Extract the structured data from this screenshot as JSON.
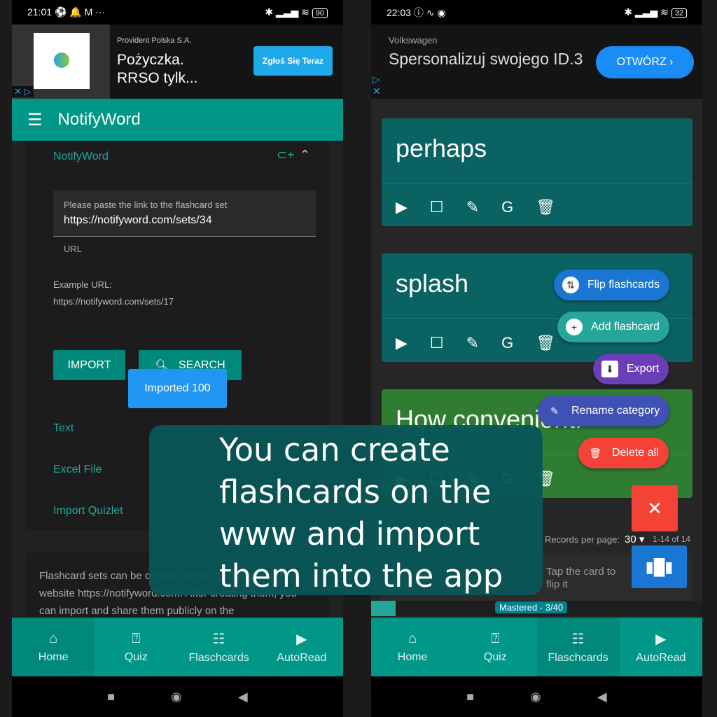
{
  "left": {
    "status": {
      "time": "21:01",
      "icons": "⚽ 🔔 M ···",
      "battery": "90"
    },
    "ad": {
      "advertiser": "Provident Polska S.A.",
      "headline": "Pożyczka. RRSO tylk...",
      "cta": "Zgłoś Się Teraz",
      "badge": "✕ ▷"
    },
    "appbar": {
      "title": "NotifyWord"
    },
    "section": {
      "title": "NotifyWord"
    },
    "url_field": {
      "label": "Please paste the link to the flashcard set",
      "value": "https://notifyword.com/sets/34",
      "helper": "URL"
    },
    "example": {
      "label": "Example URL:",
      "value": "https://notifyword.com/sets/17"
    },
    "buttons": {
      "import": "IMPORT",
      "search": "SEARCH"
    },
    "toast": "Imported 100",
    "sections": [
      "Text",
      "Excel File",
      "Import Quizlet"
    ],
    "info": "Flashcard sets can be created on the computer on the website https://notifyword.com. After creating them, you can import and share them publicly on the",
    "nav": [
      {
        "label": "Home",
        "icon": "home-icon"
      },
      {
        "label": "Quiz",
        "icon": "quiz-icon"
      },
      {
        "label": "Flaschcards",
        "icon": "list-icon"
      },
      {
        "label": "AutoRead",
        "icon": "play-icon"
      }
    ]
  },
  "right": {
    "status": {
      "time": "22:03",
      "battery": "32"
    },
    "ad": {
      "advertiser": "Volkswagen",
      "headline": "Spersonalizuj swojego ID.3",
      "cta": "OTWÓRZ ›"
    },
    "cards": [
      {
        "word": "perhaps",
        "color": "#0b6262"
      },
      {
        "word": "splash",
        "color": "#0b6262"
      },
      {
        "word": "How convenient!",
        "color": "#2e7d32"
      }
    ],
    "fab_menu": [
      {
        "label": "Flip flashcards",
        "color": "#1976d2"
      },
      {
        "label": "Add flashcard",
        "color": "#26a69a"
      },
      {
        "label": "Export",
        "color": "#6a3fb5"
      },
      {
        "label": "Rename category",
        "color": "#3f51b5"
      },
      {
        "label": "Delete all",
        "color": "#f44336"
      }
    ],
    "pagination": {
      "label": "Records per page:",
      "value": "30",
      "range": "1-14 of 14"
    },
    "hint": "Tap the card to flip it",
    "mastered": "Mastered - 3/40",
    "mastered_fraction": 0.075,
    "nav": [
      {
        "label": "Home"
      },
      {
        "label": "Quiz"
      },
      {
        "label": "Flaschcards"
      },
      {
        "label": "AutoRead"
      }
    ]
  },
  "overlay": {
    "text": "You can create flashcards on the www and import them into the app"
  }
}
